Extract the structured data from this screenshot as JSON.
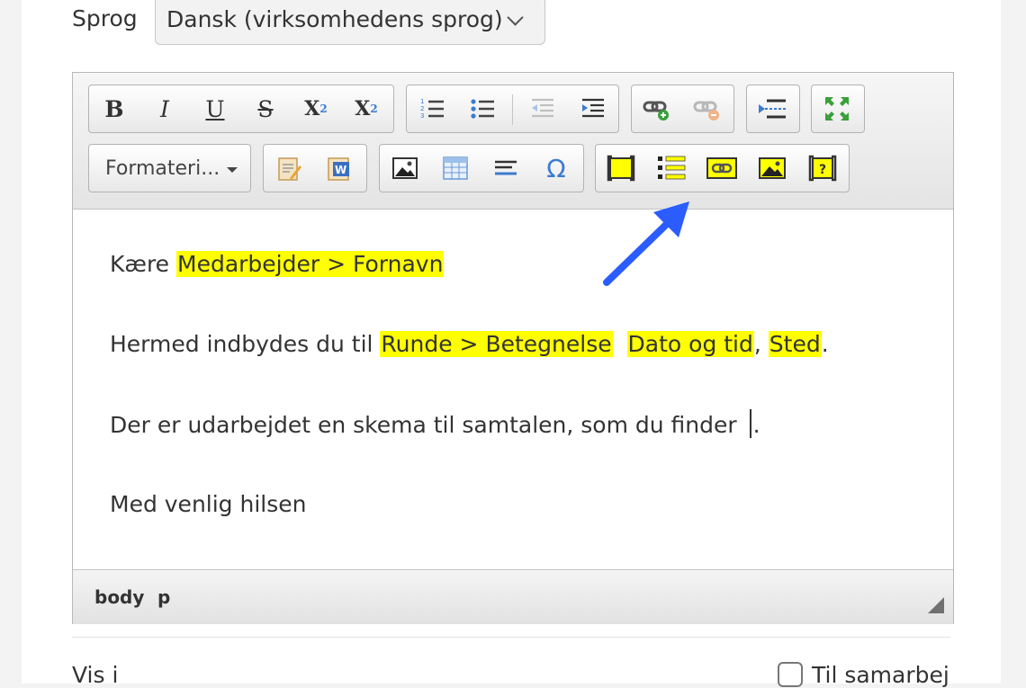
{
  "language": {
    "label": "Sprog",
    "selected": "Dansk (virksomhedens sprog)"
  },
  "toolbar": {
    "row1": {
      "basic_styles": [
        "bold-icon",
        "italic-icon",
        "underline-icon",
        "strikethrough-icon",
        "subscript-icon",
        "superscript-icon"
      ],
      "lists": [
        "numbered-list-icon",
        "bulleted-list-icon",
        "outdent-icon",
        "indent-icon"
      ],
      "links": [
        "link-icon",
        "unlink-icon"
      ],
      "misc": [
        "horizontal-line-icon"
      ],
      "tools": [
        "maximize-icon"
      ]
    },
    "format_label": "Formateri...",
    "row2": {
      "paste": [
        "paste-text-icon",
        "paste-word-icon"
      ],
      "insert": [
        "image-icon",
        "table-icon",
        "horizontal-rule-icon",
        "special-char-icon"
      ],
      "placeholders": [
        "field-placeholder-icon",
        "list-placeholder-icon",
        "link-placeholder-icon",
        "image-placeholder-icon",
        "question-placeholder-icon"
      ]
    }
  },
  "content": {
    "p1": {
      "before": "Kære ",
      "field": "Medarbejder > Fornavn"
    },
    "p2": {
      "before": "Hermed indbydes du til ",
      "field1": "Runde > Betegnelse",
      "field2": "Dato og tid",
      "comma": ",",
      "field3": "Sted",
      "end": "."
    },
    "p3": {
      "text": "Der er udarbejdet en skema til samtalen, som du finder ",
      "end": "."
    },
    "p4": {
      "text": "Med venlig hilsen"
    }
  },
  "statusbar": {
    "path": [
      "body",
      "p"
    ]
  },
  "footer": {
    "left_text": "Vis i",
    "right_text": "Til samarbej"
  },
  "colors": {
    "highlight": "#ffff00",
    "arrow": "#2a5cff"
  }
}
